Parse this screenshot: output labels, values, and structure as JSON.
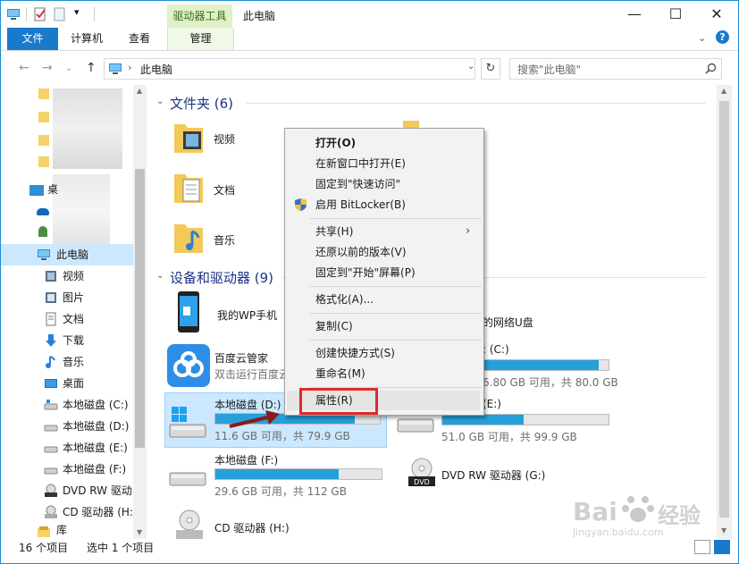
{
  "titlebar": {
    "context_tab_group": "驱动器工具",
    "title": "此电脑"
  },
  "ribbon": {
    "tabs": [
      "文件",
      "计算机",
      "查看",
      "管理"
    ]
  },
  "address": {
    "path": "此电脑",
    "search_placeholder": "搜索\"此电脑\""
  },
  "nav": {
    "items": [
      {
        "label": "此电脑",
        "icon": "computer-icon"
      },
      {
        "label": "视频",
        "icon": "video-folder-icon"
      },
      {
        "label": "图片",
        "icon": "pictures-folder-icon"
      },
      {
        "label": "文档",
        "icon": "documents-folder-icon"
      },
      {
        "label": "下载",
        "icon": "download-icon"
      },
      {
        "label": "音乐",
        "icon": "music-icon"
      },
      {
        "label": "桌面",
        "icon": "desktop-icon"
      },
      {
        "label": "本地磁盘 (C:)",
        "icon": "drive-icon"
      },
      {
        "label": "本地磁盘 (D:)",
        "icon": "drive-icon"
      },
      {
        "label": "本地磁盘 (E:)",
        "icon": "drive-icon"
      },
      {
        "label": "本地磁盘 (F:)",
        "icon": "drive-icon"
      },
      {
        "label": "DVD RW 驱动",
        "icon": "dvd-icon"
      },
      {
        "label": "CD 驱动器 (H:",
        "icon": "cd-icon"
      },
      {
        "label": "库",
        "icon": "library-icon"
      }
    ],
    "partial_label": "桌"
  },
  "content": {
    "folders_header": "文件夹 (6)",
    "folders": [
      {
        "name": "视频"
      },
      {
        "name": "文档"
      },
      {
        "name": "音乐"
      }
    ],
    "devices_header": "设备和驱动器 (9)",
    "devices": {
      "phone": {
        "name": "我的WP手机"
      },
      "netdisk_partial": "的网络U盘",
      "baidu": {
        "name": "百度云管家",
        "sub": "双击运行百度云"
      },
      "drive_c": {
        "name_partial": ": (C:)",
        "free": "6.80 GB 可用，共 80.0 GB",
        "used_fraction": 0.92
      },
      "drive_d": {
        "name": "本地磁盘 (D:)",
        "free": "11.6 GB 可用，共 79.9 GB",
        "used_fraction": 0.85
      },
      "drive_e": {
        "name_partial": "(E:)",
        "free": "51.0 GB 可用，共 99.9 GB",
        "used_fraction": 0.49
      },
      "drive_f": {
        "name": "本地磁盘 (F:)",
        "free": "29.6 GB 可用，共 112 GB",
        "used_fraction": 0.74
      },
      "dvd": {
        "name": "DVD RW 驱动器 (G:)"
      },
      "cd": {
        "name": "CD 驱动器 (H:)"
      }
    }
  },
  "context_menu": {
    "items": [
      {
        "label": "打开(O)",
        "bold": true
      },
      {
        "label": "在新窗口中打开(E)"
      },
      {
        "label": "固定到\"快速访问\""
      },
      {
        "label": "启用 BitLocker(B)",
        "icon": "uac-shield-icon"
      },
      {
        "label": "共享(H)",
        "submenu": true
      },
      {
        "label": "还原以前的版本(V)"
      },
      {
        "label": "固定到\"开始\"屏幕(P)"
      },
      {
        "label": "格式化(A)..."
      },
      {
        "label": "复制(C)"
      },
      {
        "label": "创建快捷方式(S)"
      },
      {
        "label": "重命名(M)"
      },
      {
        "label": "属性(R)",
        "highlighted": true
      }
    ]
  },
  "status": {
    "count": "16 个项目",
    "selection": "选中 1 个项目"
  },
  "watermark": {
    "brand": "Bai",
    "brand_cn": "经验",
    "url": "jingyan.baidu.com"
  },
  "colors": {
    "accent": "#1979ca",
    "bar_fill": "#26a0da",
    "highlight_box": "#e0292b",
    "selection": "#cce8ff"
  }
}
